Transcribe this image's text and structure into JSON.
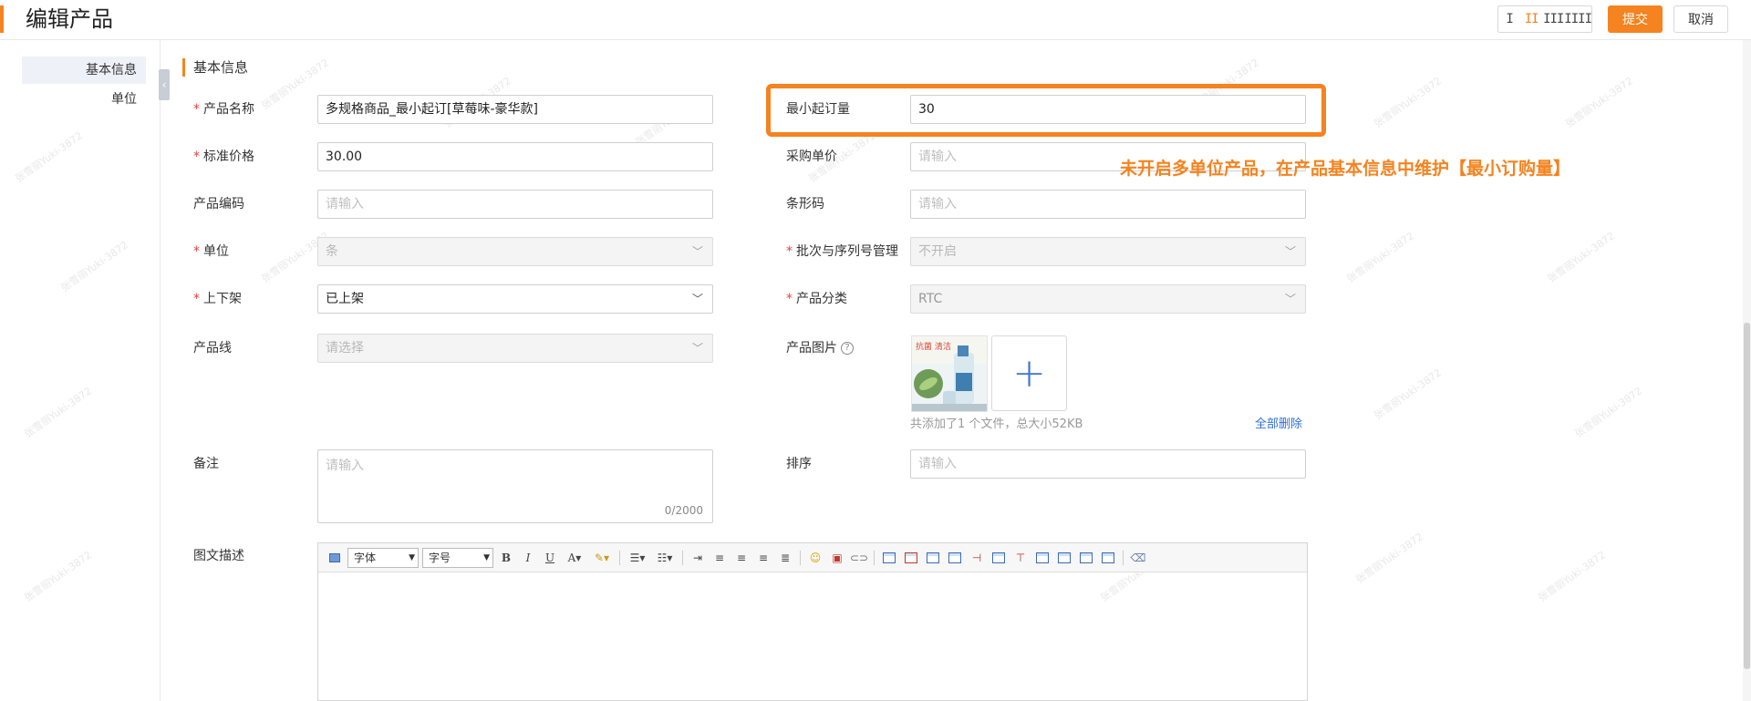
{
  "header": {
    "title": "编辑产品",
    "layout_options": [
      "I",
      "II",
      "III",
      "IIII"
    ],
    "layout_active_index": 1,
    "submit_label": "提交",
    "cancel_label": "取消"
  },
  "sidebar": {
    "items": [
      {
        "label": "基本信息",
        "active": true
      },
      {
        "label": "单位",
        "active": false
      }
    ],
    "collapse_glyph": "‹"
  },
  "watermark_text": "张雪丽Yuki-3872",
  "section": {
    "title": "基本信息"
  },
  "form": {
    "product_name": {
      "label": "产品名称",
      "value": "多规格商品_最小起订[草莓味-豪华款]",
      "required": true
    },
    "min_order_qty": {
      "label": "最小起订量",
      "value": "30",
      "required": false
    },
    "standard_price": {
      "label": "标准价格",
      "value": "30.00",
      "required": true
    },
    "purchase_price": {
      "label": "采购单价",
      "placeholder": "请输入",
      "required": false
    },
    "product_code": {
      "label": "产品编码",
      "placeholder": "请输入",
      "required": false
    },
    "barcode": {
      "label": "条形码",
      "placeholder": "请输入",
      "required": false
    },
    "unit": {
      "label": "单位",
      "value": "条",
      "required": true,
      "disabled": true
    },
    "batch_serial": {
      "label": "批次与序列号管理",
      "value": "不开启",
      "required": true,
      "disabled": true
    },
    "listing_status": {
      "label": "上下架",
      "value": "已上架",
      "required": true
    },
    "category": {
      "label": "产品分类",
      "value": "RTC",
      "required": true,
      "disabled": true
    },
    "product_line": {
      "label": "产品线",
      "placeholder": "请选择",
      "required": false,
      "disabled": true
    },
    "product_image": {
      "label": "产品图片",
      "help_glyph": "?",
      "file_info": "共添加了1 个文件，总大小52KB",
      "delete_all_label": "全部删除",
      "upload_glyph": "+",
      "thumb_text": "抗菌 清洁"
    },
    "remark": {
      "label": "备注",
      "placeholder": "请输入",
      "counter": "0/2000"
    },
    "sort": {
      "label": "排序",
      "placeholder": "请输入"
    },
    "rich_desc": {
      "label": "图文描述",
      "font_select": "字体",
      "size_select": "字号"
    }
  },
  "annotation": "未开启多单位产品，在产品基本信息中维护【最小订购量】",
  "colors": {
    "accent": "#f5831f",
    "link": "#2f6fd6",
    "required": "#e8413c"
  }
}
